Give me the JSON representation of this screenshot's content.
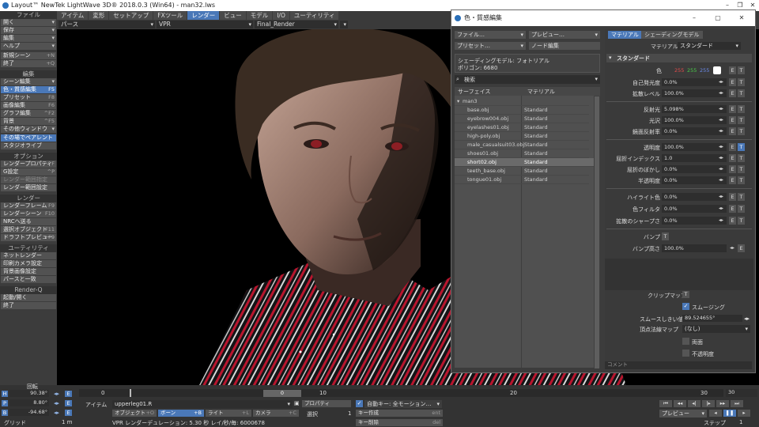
{
  "window": {
    "title": "Layout™ NewTek LightWave 3D® 2018.0.3 (Win64) - man32.lws"
  },
  "left_panel": {
    "file_header": "ファイル",
    "file_items": [
      {
        "label": "開く"
      },
      {
        "label": "保存"
      },
      {
        "label": "編集"
      },
      {
        "label": "ヘルプ"
      }
    ],
    "new_scene": {
      "label": "新規シーン",
      "shortcut": "+N"
    },
    "quit": {
      "label": "終了",
      "shortcut": "+Q"
    },
    "edit_header": "編集",
    "edit_items": [
      {
        "label": "シーン編集",
        "shortcut": ""
      },
      {
        "label": "色・質感編集",
        "shortcut": "F5"
      },
      {
        "label": "プリセット",
        "shortcut": "F8"
      },
      {
        "label": "画像編集",
        "shortcut": "F6"
      },
      {
        "label": "グラフ編集",
        "shortcut": "^F2"
      },
      {
        "label": "背景",
        "shortcut": "^F5"
      },
      {
        "label": "その他ウィンドウ",
        "shortcut": ""
      },
      {
        "label": "その場でペアレント",
        "shortcut": ""
      },
      {
        "label": "スタジオライブ",
        "shortcut": ""
      }
    ],
    "options_header": "オプション",
    "options_items": [
      {
        "label": "レンダープロパティ",
        "shortcut": "^F"
      },
      {
        "label": "G設定",
        "shortcut": "^P"
      },
      {
        "label": "レンダー範囲指定",
        "shortcut": ""
      },
      {
        "label": "レンダー範囲設定",
        "shortcut": ""
      }
    ],
    "render_header": "レンダー",
    "render_items": [
      {
        "label": "レンダーフレーム",
        "shortcut": "F9"
      },
      {
        "label": "レンダーシーン",
        "shortcut": "F10"
      },
      {
        "label": "NRCへ送る",
        "shortcut": ""
      },
      {
        "label": "選択オブジェクト",
        "shortcut": "F11"
      },
      {
        "label": "ドラフトプレビュー",
        "shortcut": "+F9"
      }
    ],
    "utility_header": "ユーティリティ",
    "utility_items": [
      {
        "label": "ネットレンダー"
      },
      {
        "label": "印刷カメラ設定"
      },
      {
        "label": "背景画像設定"
      },
      {
        "label": "パースと一致"
      }
    ],
    "renderq_header": "Render-Q",
    "renderq_items": [
      {
        "label": "起動/開く"
      },
      {
        "label": "終了"
      }
    ]
  },
  "tabs": [
    {
      "label": "アイテム"
    },
    {
      "label": "変形"
    },
    {
      "label": "セットアップ"
    },
    {
      "label": "FXツール"
    },
    {
      "label": "レンダー"
    },
    {
      "label": "ビュー"
    },
    {
      "label": "モデル"
    },
    {
      "label": "I/O"
    },
    {
      "label": "ユーティリティ"
    }
  ],
  "view_toolbar": {
    "view_mode": "パース",
    "render_mode": "VPR",
    "render_target": "Final_Render"
  },
  "dialog": {
    "title": "色・質感編集",
    "file_menu": "ファイル…",
    "preview_menu": "プレビュー…",
    "preset_menu": "プリセット…",
    "node_edit": "ノード編集",
    "shading_model_info": "シェーディングモデル: フォトリアル",
    "polygon_info": "ポリゴン:  6680",
    "search_placeholder": "検索",
    "col_surface": "サーフェイス",
    "col_material": "マテリアル",
    "surfaces": [
      {
        "name": "man3",
        "material": ""
      },
      {
        "name": "base.obj",
        "material": "Standard"
      },
      {
        "name": "eyebrow004.obj",
        "material": "Standard"
      },
      {
        "name": "eyelashes01.obj",
        "material": "Standard"
      },
      {
        "name": "high-poly.obj",
        "material": "Standard"
      },
      {
        "name": "male_casualsuit03.obj",
        "material": "Standard"
      },
      {
        "name": "shoes01.obj",
        "material": "Standard"
      },
      {
        "name": "short02.obj",
        "material": "Standard"
      },
      {
        "name": "teeth_base.obj",
        "material": "Standard"
      },
      {
        "name": "tongue01.obj",
        "material": "Standard"
      }
    ],
    "right_tabs": [
      {
        "label": "マテリアル"
      },
      {
        "label": "シェーディングモデル"
      }
    ],
    "material_label": "マテリアル",
    "material_value": "スタンダード",
    "section_label": "スタンダード",
    "color_label": "色",
    "color_rgb": {
      "r": "255",
      "g": "255",
      "b": "255"
    },
    "props_a": [
      {
        "label": "自己発光度",
        "value": "0.0%"
      },
      {
        "label": "拡散レベル",
        "value": "100.0%"
      }
    ],
    "props_b": [
      {
        "label": "反射光",
        "value": "5.098%"
      },
      {
        "label": "光沢",
        "value": "100.0%"
      },
      {
        "label": "鏡面反射率",
        "value": "0.0%"
      }
    ],
    "props_c": [
      {
        "label": "透明度",
        "value": "100.0%"
      },
      {
        "label": "屈折インデックス",
        "value": "1.0"
      },
      {
        "label": "屈折のぼかし",
        "value": "0.0%"
      },
      {
        "label": "半透明度",
        "value": "0.0%"
      }
    ],
    "props_d": [
      {
        "label": "ハイライト色",
        "value": "0.0%"
      },
      {
        "label": "色フィルタ",
        "value": "0.0%"
      },
      {
        "label": "拡散のシャープさ",
        "value": "0.0%"
      }
    ],
    "bump_label": "バンプ",
    "bump_height_label": "バンプ高さ",
    "bump_height_value": "100.0%",
    "clip_map_label": "クリップマップ",
    "smoothing_label": "スムージング",
    "smooth_threshold_label": "スムースしきい値",
    "smooth_threshold_value": "89.524655°",
    "vertex_normal_label": "頂点法線マップ",
    "vertex_normal_value": "(なし)",
    "double_sided_label": "両面",
    "opaque_label": "不透明度",
    "comment_label": "コメント",
    "t_label": "T",
    "e_label": "E"
  },
  "timeline": {
    "rotation_label": "回転",
    "h_value": "90.38°",
    "p_value": "8.80°",
    "b_value": "-94.68°",
    "grid_label": "グリッド",
    "grid_value": "1 m",
    "ticks": [
      "0",
      "10",
      "20",
      "30"
    ],
    "current_frame": "0",
    "end_frame": "30",
    "item_label": "アイテム",
    "item_value": "upperleg01.R",
    "properties_label": "プロパティ",
    "objects_btn": "オブジェクト",
    "bones_btn": "ボーン",
    "lights_btn": "ライト",
    "cameras_btn": "カメラ",
    "select_label": "選択",
    "select_value": "1",
    "auto_key_label": "自動キー: 全モーション…",
    "create_key": "キー作成",
    "delete_key": "キー削除",
    "status": "VPR レンダーデュレーション: 5.30 秒  レイ/秒/毎: 6000678",
    "preview_btn": "プレビュー",
    "shortcut_ent": "ent",
    "shortcut_del": "del",
    "shortcut_o": "+O",
    "shortcut_b": "+B",
    "shortcut_l": "+L",
    "shortcut_c": "+C",
    "bottom_right_label": "ステップ",
    "bottom_right_value": "1"
  }
}
